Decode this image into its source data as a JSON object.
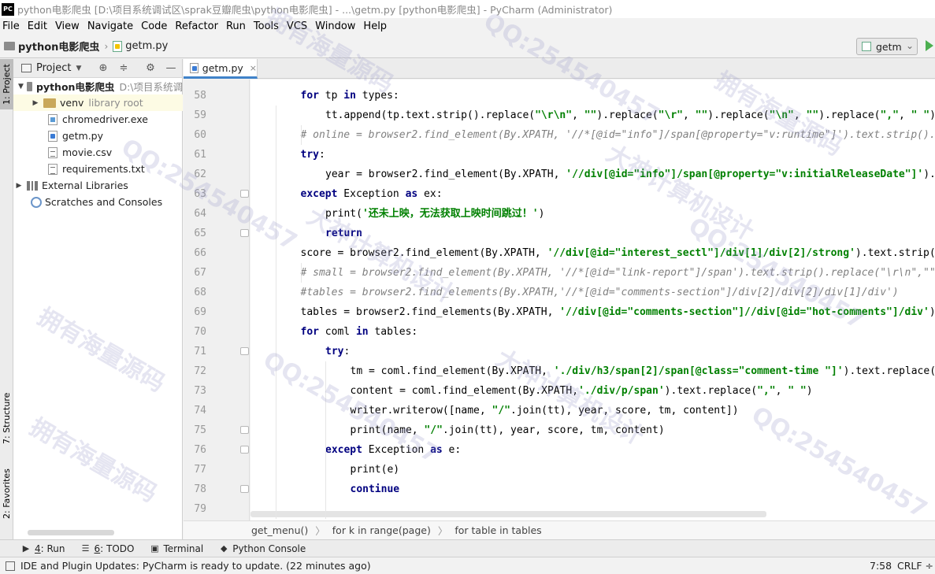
{
  "window": {
    "logo": "PC",
    "title": "python电影爬虫 [D:\\项目系统调试区\\sprak豆瓣爬虫\\python电影爬虫] - ...\\getm.py [python电影爬虫] - PyCharm (Administrator)"
  },
  "menu": [
    "File",
    "Edit",
    "View",
    "Navigate",
    "Code",
    "Refactor",
    "Run",
    "Tools",
    "VCS",
    "Window",
    "Help"
  ],
  "nav": {
    "project": "python电影爬虫",
    "file": "getm.py",
    "run_config": "getm"
  },
  "left_stripe": {
    "project_tab": "1: Project",
    "structure_tab": "7: Structure",
    "favorites_tab": "2: Favorites"
  },
  "project_panel": {
    "title": "Project",
    "tree": {
      "root": {
        "label": "python电影爬虫",
        "hint": "D:\\项目系统调"
      },
      "venv": {
        "label": "venv",
        "hint": "library root"
      },
      "files": [
        "chromedriver.exe",
        "getm.py",
        "movie.csv",
        "requirements.txt"
      ],
      "external_libraries": "External Libraries",
      "scratches": "Scratches and Consoles"
    }
  },
  "editor": {
    "tab_label": "getm.py",
    "tab_close": "×",
    "lines": [
      {
        "no": "58",
        "indent": 1,
        "tokens": [
          [
            "kw",
            "for"
          ],
          [
            "t",
            " tp "
          ],
          [
            "kw",
            "in"
          ],
          [
            "t",
            " types:"
          ]
        ]
      },
      {
        "no": "59",
        "indent": 2,
        "tokens": [
          [
            "t",
            "tt.append(tp.text.strip().replace("
          ],
          [
            "str",
            "\"\\r\\n\""
          ],
          [
            "t",
            ", "
          ],
          [
            "str",
            "\"\""
          ],
          [
            "t",
            ").replace("
          ],
          [
            "str",
            "\"\\r\""
          ],
          [
            "t",
            ", "
          ],
          [
            "str",
            "\"\""
          ],
          [
            "t",
            ").replace("
          ],
          [
            "str",
            "\"\\n\""
          ],
          [
            "t",
            ", "
          ],
          [
            "str",
            "\"\""
          ],
          [
            "t",
            ").replace("
          ],
          [
            "str",
            "\",\""
          ],
          [
            "t",
            ", "
          ],
          [
            "str",
            "\" \""
          ],
          [
            "t",
            "))"
          ]
        ]
      },
      {
        "no": "60",
        "indent": 1,
        "tokens": [
          [
            "cmt",
            "# online = browser2.find_element(By.XPATH, '//*[@id=\"info\"]/span[@property=\"v:runtime\"]').text.strip().re"
          ]
        ]
      },
      {
        "no": "61",
        "indent": 1,
        "tokens": [
          [
            "kw",
            "try"
          ],
          [
            "t",
            ":"
          ]
        ]
      },
      {
        "no": "62",
        "indent": 2,
        "tokens": [
          [
            "t",
            "year = browser2.find_element(By.XPATH, "
          ],
          [
            "str",
            "'//div[@id=\"info\"]/span[@property=\"v:initialReleaseDate\"]'"
          ],
          [
            "t",
            ").te"
          ]
        ]
      },
      {
        "no": "63",
        "indent": 1,
        "tokens": [
          [
            "kw",
            "except"
          ],
          [
            "t",
            " Exception "
          ],
          [
            "kw",
            "as"
          ],
          [
            "t",
            " ex:"
          ]
        ]
      },
      {
        "no": "64",
        "indent": 2,
        "tokens": [
          [
            "t",
            "print("
          ],
          [
            "str",
            "'还未上映，无法获取上映时间跳过！'"
          ],
          [
            "t",
            ")"
          ]
        ]
      },
      {
        "no": "65",
        "indent": 2,
        "tokens": [
          [
            "kw",
            "return"
          ]
        ]
      },
      {
        "no": "66",
        "indent": 1,
        "tokens": [
          [
            "t",
            "score = browser2.find_element(By.XPATH, "
          ],
          [
            "str",
            "'//div[@id=\"interest_sectl\"]/div[1]/div[2]/strong'"
          ],
          [
            "t",
            ").text.strip()."
          ]
        ]
      },
      {
        "no": "67",
        "indent": 1,
        "tokens": [
          [
            "cmt",
            "# small = browser2.find_element(By.XPATH, '//*[@id=\"link-report\"]/span').text.strip().replace(\"\\r\\n\",\"\")."
          ]
        ]
      },
      {
        "no": "68",
        "indent": 1,
        "tokens": [
          [
            "cmt",
            "#tables = browser2.find_elements(By.XPATH,'//*[@id=\"comments-section\"]/div[2]/div[2]/div[1]/div')"
          ]
        ]
      },
      {
        "no": "69",
        "indent": 1,
        "tokens": [
          [
            "t",
            "tables = browser2.find_elements(By.XPATH, "
          ],
          [
            "str",
            "'//div[@id=\"comments-section\"]//div[@id=\"hot-comments\"]/div'"
          ],
          [
            "t",
            ")"
          ]
        ]
      },
      {
        "no": "70",
        "indent": 1,
        "tokens": [
          [
            "kw",
            "for"
          ],
          [
            "t",
            " coml "
          ],
          [
            "kw",
            "in"
          ],
          [
            "t",
            " tables:"
          ]
        ]
      },
      {
        "no": "71",
        "indent": 2,
        "tokens": [
          [
            "kw",
            "try"
          ],
          [
            "t",
            ":"
          ]
        ]
      },
      {
        "no": "72",
        "indent": 3,
        "tokens": [
          [
            "t",
            "tm = coml.find_element(By.XPATH, "
          ],
          [
            "str",
            "'./div/h3/span[2]/span[@class=\"comment-time \"]'"
          ],
          [
            "t",
            ").text.replace("
          ],
          [
            "str",
            "\","
          ]
        ]
      },
      {
        "no": "73",
        "indent": 3,
        "tokens": [
          [
            "t",
            "content = coml.find_element(By.XPATH,"
          ],
          [
            "str",
            "'./div/p/span'"
          ],
          [
            "t",
            ").text.replace("
          ],
          [
            "str",
            "\",\""
          ],
          [
            "t",
            ", "
          ],
          [
            "str",
            "\" \""
          ],
          [
            "t",
            ")"
          ]
        ]
      },
      {
        "no": "74",
        "indent": 3,
        "tokens": [
          [
            "t",
            "writer.writerow([name, "
          ],
          [
            "str",
            "\"/\""
          ],
          [
            "t",
            ".join(tt), year, score, tm, content])"
          ]
        ]
      },
      {
        "no": "75",
        "indent": 3,
        "tokens": [
          [
            "t",
            "print(name, "
          ],
          [
            "str",
            "\"/\""
          ],
          [
            "t",
            ".join(tt), year, score, tm, content)"
          ]
        ]
      },
      {
        "no": "76",
        "indent": 2,
        "tokens": [
          [
            "kw",
            "except"
          ],
          [
            "t",
            " Exception "
          ],
          [
            "kw",
            "as"
          ],
          [
            "t",
            " e:"
          ]
        ]
      },
      {
        "no": "77",
        "indent": 3,
        "tokens": [
          [
            "t",
            "print(e)"
          ]
        ]
      },
      {
        "no": "78",
        "indent": 3,
        "tokens": [
          [
            "kw",
            "continue"
          ]
        ]
      },
      {
        "no": "79",
        "indent": 0,
        "tokens": []
      }
    ],
    "fold_lines": [
      "63",
      "65",
      "71",
      "75",
      "76",
      "78"
    ]
  },
  "breadcrumbs": [
    "get_menu()",
    "for k in range(page)",
    "for table in tables"
  ],
  "breadcrumb_sep": "〉",
  "toolwindows": [
    {
      "icon": "▶",
      "mnemonic": "4",
      "label": ": Run"
    },
    {
      "icon": "☰",
      "mnemonic": "6",
      "label": ": TODO"
    },
    {
      "icon": "▣",
      "mnemonic": "",
      "label": "Terminal"
    },
    {
      "icon": "◆",
      "mnemonic": "",
      "label": "Python Console"
    }
  ],
  "status": {
    "message": "IDE and Plugin Updates: PyCharm is ready to update. (22 minutes ago)",
    "position": "7:58",
    "line_sep": "CRLF ÷"
  },
  "watermarks": [
    "QQ:254540457",
    "拥有海量源码",
    "大神计算机设计",
    "QQ:254540457",
    "拥有海量源码",
    "大神计算机设计",
    "QQ:254540457",
    "拥有海量源码",
    "QQ:254540457",
    "大神计算机设计",
    "拥有海量源码",
    "QQ:254540457"
  ]
}
